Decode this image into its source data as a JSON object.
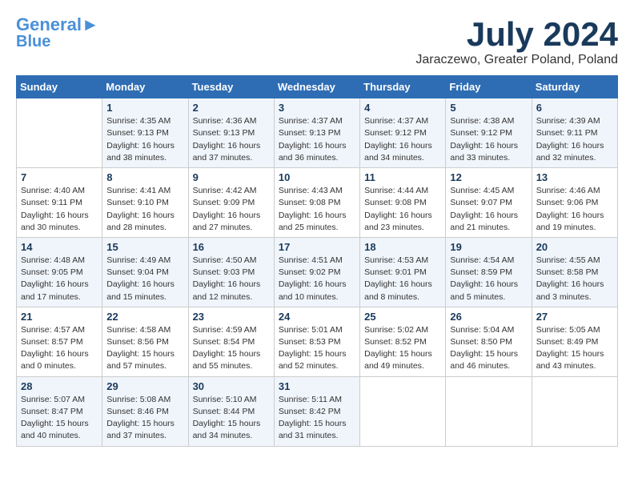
{
  "header": {
    "logo_line1": "General",
    "logo_line2": "Blue",
    "month": "July 2024",
    "location": "Jaraczewo, Greater Poland, Poland"
  },
  "weekdays": [
    "Sunday",
    "Monday",
    "Tuesday",
    "Wednesday",
    "Thursday",
    "Friday",
    "Saturday"
  ],
  "weeks": [
    [
      {
        "day": "",
        "sunrise": "",
        "sunset": "",
        "daylight": ""
      },
      {
        "day": "1",
        "sunrise": "Sunrise: 4:35 AM",
        "sunset": "Sunset: 9:13 PM",
        "daylight": "Daylight: 16 hours and 38 minutes."
      },
      {
        "day": "2",
        "sunrise": "Sunrise: 4:36 AM",
        "sunset": "Sunset: 9:13 PM",
        "daylight": "Daylight: 16 hours and 37 minutes."
      },
      {
        "day": "3",
        "sunrise": "Sunrise: 4:37 AM",
        "sunset": "Sunset: 9:13 PM",
        "daylight": "Daylight: 16 hours and 36 minutes."
      },
      {
        "day": "4",
        "sunrise": "Sunrise: 4:37 AM",
        "sunset": "Sunset: 9:12 PM",
        "daylight": "Daylight: 16 hours and 34 minutes."
      },
      {
        "day": "5",
        "sunrise": "Sunrise: 4:38 AM",
        "sunset": "Sunset: 9:12 PM",
        "daylight": "Daylight: 16 hours and 33 minutes."
      },
      {
        "day": "6",
        "sunrise": "Sunrise: 4:39 AM",
        "sunset": "Sunset: 9:11 PM",
        "daylight": "Daylight: 16 hours and 32 minutes."
      }
    ],
    [
      {
        "day": "7",
        "sunrise": "Sunrise: 4:40 AM",
        "sunset": "Sunset: 9:11 PM",
        "daylight": "Daylight: 16 hours and 30 minutes."
      },
      {
        "day": "8",
        "sunrise": "Sunrise: 4:41 AM",
        "sunset": "Sunset: 9:10 PM",
        "daylight": "Daylight: 16 hours and 28 minutes."
      },
      {
        "day": "9",
        "sunrise": "Sunrise: 4:42 AM",
        "sunset": "Sunset: 9:09 PM",
        "daylight": "Daylight: 16 hours and 27 minutes."
      },
      {
        "day": "10",
        "sunrise": "Sunrise: 4:43 AM",
        "sunset": "Sunset: 9:08 PM",
        "daylight": "Daylight: 16 hours and 25 minutes."
      },
      {
        "day": "11",
        "sunrise": "Sunrise: 4:44 AM",
        "sunset": "Sunset: 9:08 PM",
        "daylight": "Daylight: 16 hours and 23 minutes."
      },
      {
        "day": "12",
        "sunrise": "Sunrise: 4:45 AM",
        "sunset": "Sunset: 9:07 PM",
        "daylight": "Daylight: 16 hours and 21 minutes."
      },
      {
        "day": "13",
        "sunrise": "Sunrise: 4:46 AM",
        "sunset": "Sunset: 9:06 PM",
        "daylight": "Daylight: 16 hours and 19 minutes."
      }
    ],
    [
      {
        "day": "14",
        "sunrise": "Sunrise: 4:48 AM",
        "sunset": "Sunset: 9:05 PM",
        "daylight": "Daylight: 16 hours and 17 minutes."
      },
      {
        "day": "15",
        "sunrise": "Sunrise: 4:49 AM",
        "sunset": "Sunset: 9:04 PM",
        "daylight": "Daylight: 16 hours and 15 minutes."
      },
      {
        "day": "16",
        "sunrise": "Sunrise: 4:50 AM",
        "sunset": "Sunset: 9:03 PM",
        "daylight": "Daylight: 16 hours and 12 minutes."
      },
      {
        "day": "17",
        "sunrise": "Sunrise: 4:51 AM",
        "sunset": "Sunset: 9:02 PM",
        "daylight": "Daylight: 16 hours and 10 minutes."
      },
      {
        "day": "18",
        "sunrise": "Sunrise: 4:53 AM",
        "sunset": "Sunset: 9:01 PM",
        "daylight": "Daylight: 16 hours and 8 minutes."
      },
      {
        "day": "19",
        "sunrise": "Sunrise: 4:54 AM",
        "sunset": "Sunset: 8:59 PM",
        "daylight": "Daylight: 16 hours and 5 minutes."
      },
      {
        "day": "20",
        "sunrise": "Sunrise: 4:55 AM",
        "sunset": "Sunset: 8:58 PM",
        "daylight": "Daylight: 16 hours and 3 minutes."
      }
    ],
    [
      {
        "day": "21",
        "sunrise": "Sunrise: 4:57 AM",
        "sunset": "Sunset: 8:57 PM",
        "daylight": "Daylight: 16 hours and 0 minutes."
      },
      {
        "day": "22",
        "sunrise": "Sunrise: 4:58 AM",
        "sunset": "Sunset: 8:56 PM",
        "daylight": "Daylight: 15 hours and 57 minutes."
      },
      {
        "day": "23",
        "sunrise": "Sunrise: 4:59 AM",
        "sunset": "Sunset: 8:54 PM",
        "daylight": "Daylight: 15 hours and 55 minutes."
      },
      {
        "day": "24",
        "sunrise": "Sunrise: 5:01 AM",
        "sunset": "Sunset: 8:53 PM",
        "daylight": "Daylight: 15 hours and 52 minutes."
      },
      {
        "day": "25",
        "sunrise": "Sunrise: 5:02 AM",
        "sunset": "Sunset: 8:52 PM",
        "daylight": "Daylight: 15 hours and 49 minutes."
      },
      {
        "day": "26",
        "sunrise": "Sunrise: 5:04 AM",
        "sunset": "Sunset: 8:50 PM",
        "daylight": "Daylight: 15 hours and 46 minutes."
      },
      {
        "day": "27",
        "sunrise": "Sunrise: 5:05 AM",
        "sunset": "Sunset: 8:49 PM",
        "daylight": "Daylight: 15 hours and 43 minutes."
      }
    ],
    [
      {
        "day": "28",
        "sunrise": "Sunrise: 5:07 AM",
        "sunset": "Sunset: 8:47 PM",
        "daylight": "Daylight: 15 hours and 40 minutes."
      },
      {
        "day": "29",
        "sunrise": "Sunrise: 5:08 AM",
        "sunset": "Sunset: 8:46 PM",
        "daylight": "Daylight: 15 hours and 37 minutes."
      },
      {
        "day": "30",
        "sunrise": "Sunrise: 5:10 AM",
        "sunset": "Sunset: 8:44 PM",
        "daylight": "Daylight: 15 hours and 34 minutes."
      },
      {
        "day": "31",
        "sunrise": "Sunrise: 5:11 AM",
        "sunset": "Sunset: 8:42 PM",
        "daylight": "Daylight: 15 hours and 31 minutes."
      },
      {
        "day": "",
        "sunrise": "",
        "sunset": "",
        "daylight": ""
      },
      {
        "day": "",
        "sunrise": "",
        "sunset": "",
        "daylight": ""
      },
      {
        "day": "",
        "sunrise": "",
        "sunset": "",
        "daylight": ""
      }
    ]
  ]
}
